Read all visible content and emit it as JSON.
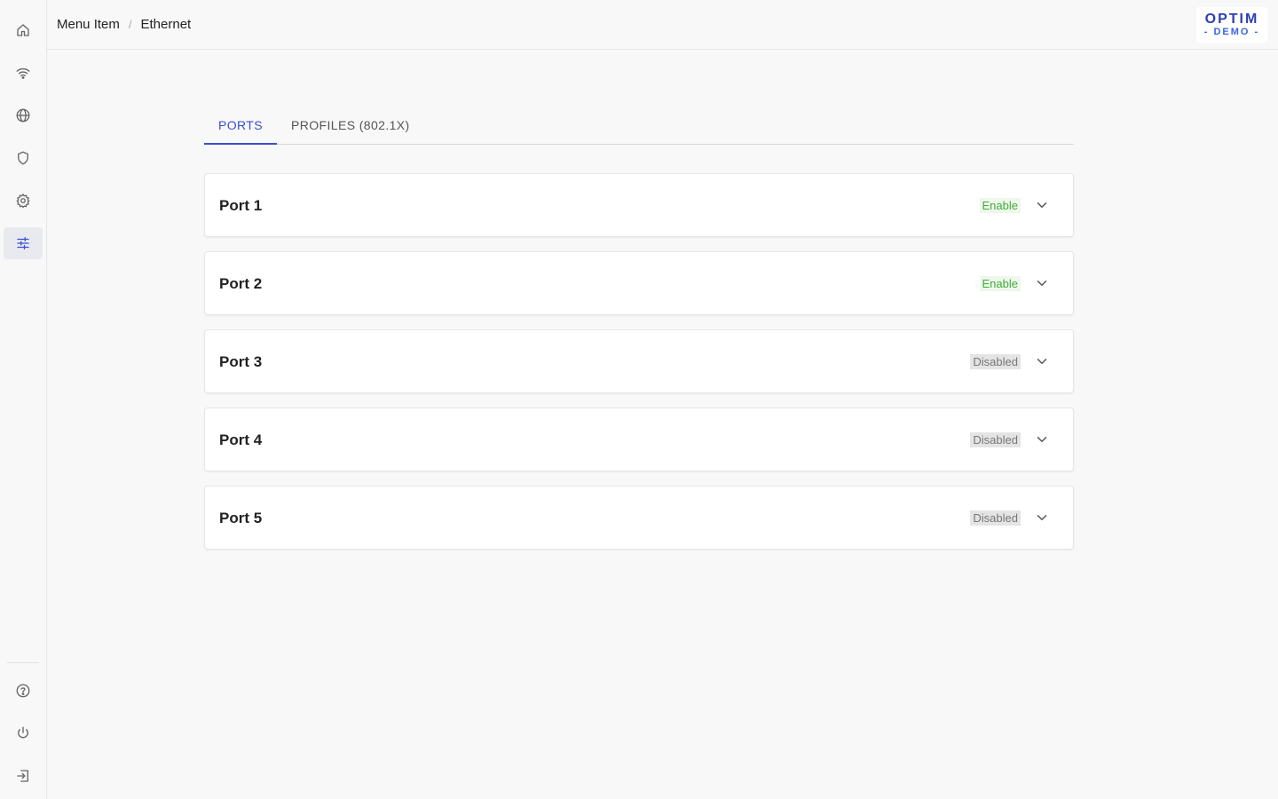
{
  "sidebar": {
    "top_items": [
      {
        "icon": "home-icon"
      },
      {
        "icon": "wifi-icon"
      },
      {
        "icon": "globe-icon"
      },
      {
        "icon": "shield-icon"
      },
      {
        "icon": "gear-icon"
      },
      {
        "icon": "sliders-icon",
        "active": true
      }
    ],
    "bottom_items": [
      {
        "icon": "help-icon"
      },
      {
        "icon": "power-icon"
      },
      {
        "icon": "logout-icon"
      }
    ]
  },
  "header": {
    "breadcrumb": [
      "Menu Item",
      "Ethernet"
    ],
    "breadcrumb_separator": "/",
    "logo": {
      "main": "OPTIM",
      "sub": "- DEMO -"
    }
  },
  "tabs": [
    {
      "label": "PORTS",
      "active": true
    },
    {
      "label": "PROFILES (802.1X)",
      "active": false
    }
  ],
  "ports": [
    {
      "name": "Port 1",
      "status": "Enable"
    },
    {
      "name": "Port 2",
      "status": "Enable"
    },
    {
      "name": "Port 3",
      "status": "Disabled"
    },
    {
      "name": "Port 4",
      "status": "Disabled"
    },
    {
      "name": "Port 5",
      "status": "Disabled"
    }
  ],
  "colors": {
    "accent": "#3a4fd1",
    "enable": "#3fae3a",
    "disabled": "#777777"
  }
}
